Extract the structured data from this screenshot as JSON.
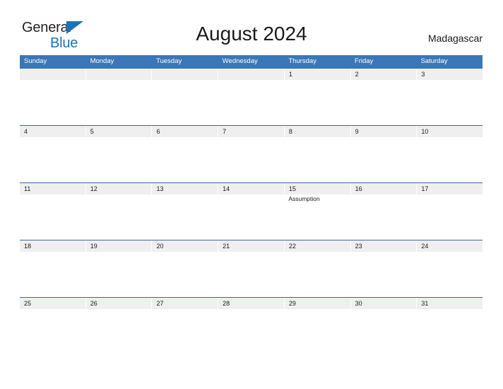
{
  "brand": {
    "line1": "General",
    "line2": "Blue",
    "accent_color": "#1b72b8"
  },
  "header": {
    "title": "August 2024",
    "country": "Madagascar"
  },
  "calendar": {
    "header_color": "#3a77b8",
    "date_band_color": "#efefef",
    "row_divider_color": "#2f6ca8",
    "weekdays": [
      "Sunday",
      "Monday",
      "Tuesday",
      "Wednesday",
      "Thursday",
      "Friday",
      "Saturday"
    ],
    "weeks": [
      {
        "days": [
          {
            "date": "",
            "event": ""
          },
          {
            "date": "",
            "event": ""
          },
          {
            "date": "",
            "event": ""
          },
          {
            "date": "",
            "event": ""
          },
          {
            "date": "1",
            "event": ""
          },
          {
            "date": "2",
            "event": ""
          },
          {
            "date": "3",
            "event": ""
          }
        ]
      },
      {
        "days": [
          {
            "date": "4",
            "event": ""
          },
          {
            "date": "5",
            "event": ""
          },
          {
            "date": "6",
            "event": ""
          },
          {
            "date": "7",
            "event": ""
          },
          {
            "date": "8",
            "event": ""
          },
          {
            "date": "9",
            "event": ""
          },
          {
            "date": "10",
            "event": ""
          }
        ]
      },
      {
        "days": [
          {
            "date": "11",
            "event": ""
          },
          {
            "date": "12",
            "event": ""
          },
          {
            "date": "13",
            "event": ""
          },
          {
            "date": "14",
            "event": ""
          },
          {
            "date": "15",
            "event": "Assumption"
          },
          {
            "date": "16",
            "event": ""
          },
          {
            "date": "17",
            "event": ""
          }
        ]
      },
      {
        "days": [
          {
            "date": "18",
            "event": ""
          },
          {
            "date": "19",
            "event": ""
          },
          {
            "date": "20",
            "event": ""
          },
          {
            "date": "21",
            "event": ""
          },
          {
            "date": "22",
            "event": ""
          },
          {
            "date": "23",
            "event": ""
          },
          {
            "date": "24",
            "event": ""
          }
        ]
      },
      {
        "days": [
          {
            "date": "25",
            "event": ""
          },
          {
            "date": "26",
            "event": ""
          },
          {
            "date": "27",
            "event": ""
          },
          {
            "date": "28",
            "event": ""
          },
          {
            "date": "29",
            "event": ""
          },
          {
            "date": "30",
            "event": ""
          },
          {
            "date": "31",
            "event": ""
          }
        ]
      }
    ]
  }
}
